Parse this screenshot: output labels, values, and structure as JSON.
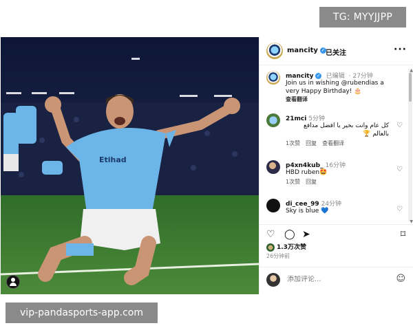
{
  "watermarks": {
    "top": "TG: MYYJJPP",
    "bottom": "vip-pandasports-app.com"
  },
  "post": {
    "photo_sponsor_text": "Etihad",
    "author": "mancity",
    "follow_status": "已关注",
    "more": "···",
    "caption": {
      "user": "mancity",
      "edited": "已编辑",
      "time": "27分钟",
      "text": "Join us in wishing @rubendias a very Happy Birthday! 🎂",
      "see_translation": "查看翻译"
    },
    "comments": [
      {
        "user": "21mci",
        "time": "5分钟",
        "text": "كل عام وانت بخير يا افضل مدافع بالعالم 🏆",
        "likes": "1次赞",
        "reply": "回复",
        "see_translation": "查看翻译"
      },
      {
        "user": "p4xn4kub_",
        "time": "16分钟",
        "text": "HBD ruben🤩",
        "likes": "1次赞",
        "reply": "回复"
      },
      {
        "user": "di_cee_99",
        "time": "24分钟",
        "text": "Sky is blue 💙"
      }
    ],
    "likes_summary": "1.3万次赞",
    "time_ago": "26分钟前",
    "add_comment_placeholder": "添加评论..."
  },
  "icons": {
    "heart": "♡",
    "comment": "◯",
    "share": "➤",
    "bookmark": "⌑",
    "emoji": "☺",
    "verified": "✓"
  },
  "colors": {
    "accent": "#3897f0",
    "kit": "#6cb5e8"
  }
}
